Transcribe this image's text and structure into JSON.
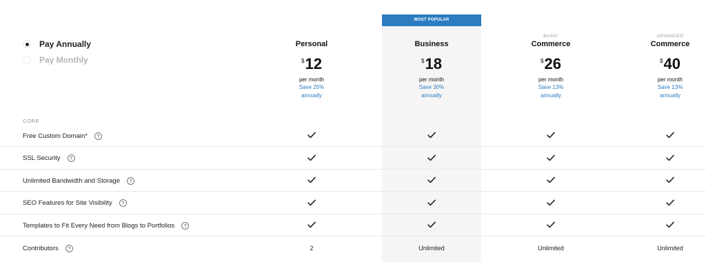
{
  "billing": {
    "annual_label": "Pay Annually",
    "monthly_label": "Pay Monthly",
    "selected": "annual"
  },
  "popular_banner": "MOST POPULAR",
  "plans": [
    {
      "tier": "",
      "name": "Personal",
      "currency": "$",
      "price": "12",
      "period": "per month",
      "save_line1": "Save 25%",
      "save_line2": "annually"
    },
    {
      "tier": "",
      "name": "Business",
      "currency": "$",
      "price": "18",
      "period": "per month",
      "save_line1": "Save 30%",
      "save_line2": "annually"
    },
    {
      "tier": "BASIC",
      "name": "Commerce",
      "currency": "$",
      "price": "26",
      "period": "per month",
      "save_line1": "Save 13%",
      "save_line2": "annually"
    },
    {
      "tier": "ADVANCED",
      "name": "Commerce",
      "currency": "$",
      "price": "40",
      "period": "per month",
      "save_line1": "Save 13%",
      "save_line2": "annually"
    }
  ],
  "section_label": "CORE",
  "help_glyph": "?",
  "features": [
    {
      "name": "Free Custom Domain*",
      "values": [
        "check",
        "check",
        "check",
        "check"
      ]
    },
    {
      "name": "SSL Security",
      "values": [
        "check",
        "check",
        "check",
        "check"
      ]
    },
    {
      "name": "Unlimited Bandwidth and Storage",
      "values": [
        "check",
        "check",
        "check",
        "check"
      ]
    },
    {
      "name": "SEO Features for Site Visibility",
      "values": [
        "check",
        "check",
        "check",
        "check"
      ]
    },
    {
      "name": "Templates to Fit Every Need from Blogs to Portfolios",
      "values": [
        "check",
        "check",
        "check",
        "check"
      ]
    },
    {
      "name": "Contributors",
      "values": [
        "2",
        "Unlimited",
        "Unlimited",
        "Unlimited"
      ]
    }
  ],
  "colors": {
    "accent": "#2b7cc1",
    "highlight_column": "#f5f5f5"
  }
}
